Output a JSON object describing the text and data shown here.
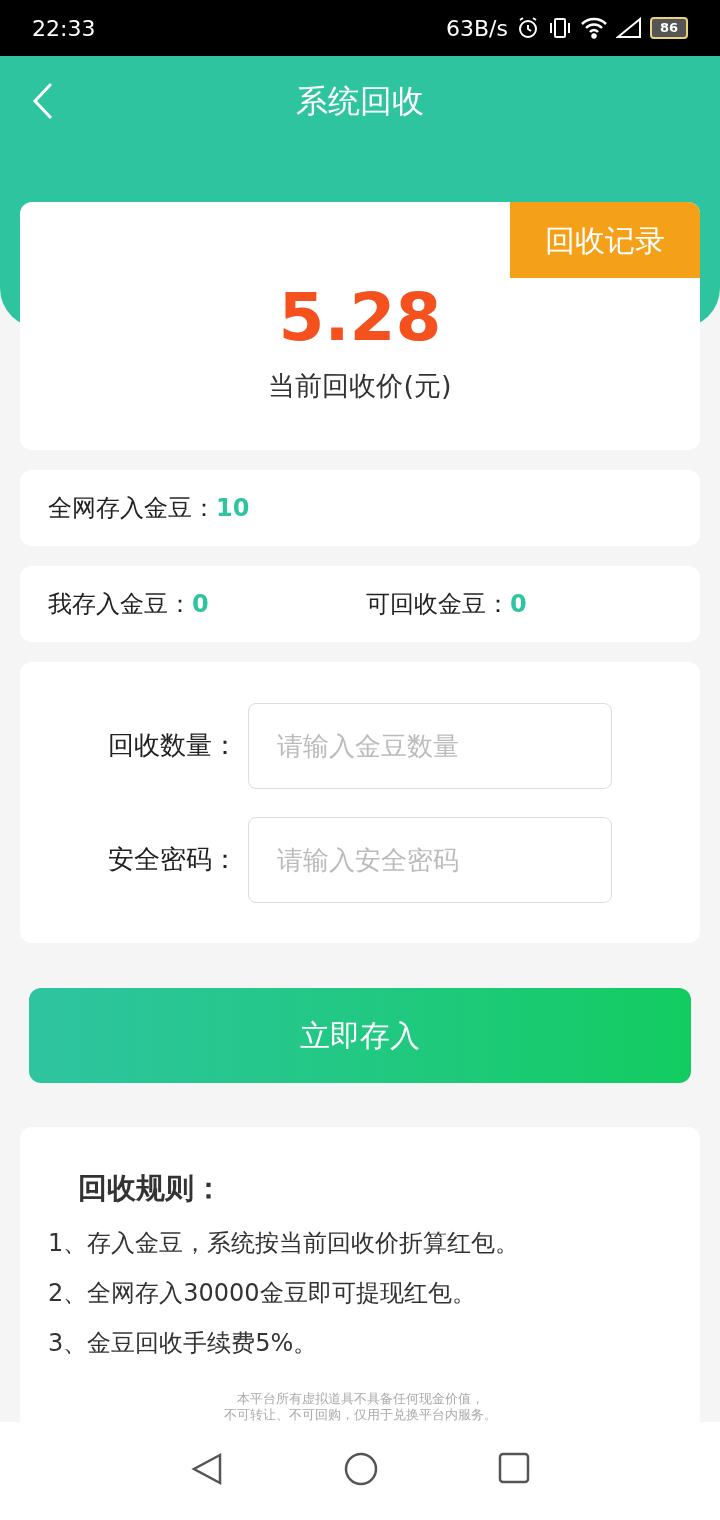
{
  "status_bar": {
    "time": "22:33",
    "speed": "63B/s",
    "battery": "86"
  },
  "header": {
    "title": "系统回收"
  },
  "price_card": {
    "badge": "回收记录",
    "price": "5.28",
    "caption": "当前回收价(元)"
  },
  "stats": [
    {
      "label": "全网存入金豆：",
      "value": "10"
    },
    {
      "label": "我存入金豆：",
      "value": "0"
    },
    {
      "label": "可回收金豆：",
      "value": "0"
    }
  ],
  "form": {
    "fields": [
      {
        "label": "回收数量：",
        "placeholder": "请输入金豆数量"
      },
      {
        "label": "安全密码：",
        "placeholder": "请输入安全密码"
      }
    ]
  },
  "submit_button": "立即存入",
  "rules": {
    "title": "回收规则：",
    "items": [
      "1、存入金豆，系统按当前回收价折算红包。",
      "2、全网存入30000金豆即可提现红包。",
      "3、金豆回收手续费5%。"
    ],
    "disclaimer": [
      "本平台所有虚拟道具不具备任何现金价值，",
      "不可转让、不可回购，仅用于兑换平台内服务。"
    ]
  }
}
